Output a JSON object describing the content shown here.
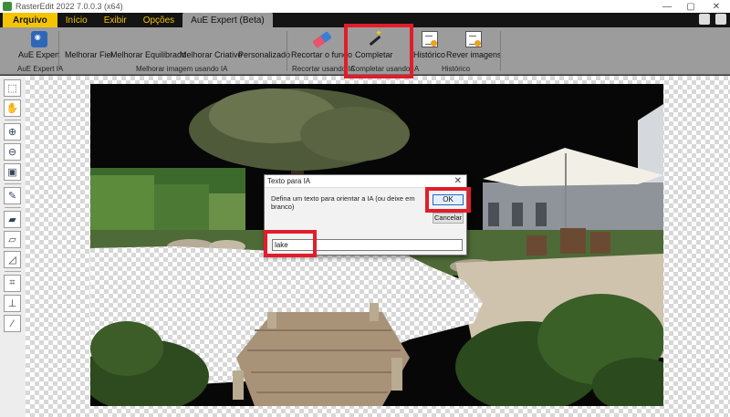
{
  "window": {
    "title": "RasterEdit 2022 7.0.0.3 (x64)",
    "min_glyph": "—",
    "max_glyph": "▢",
    "close_glyph": "✕"
  },
  "tabs": [
    {
      "label": "Arquivo"
    },
    {
      "label": "Início"
    },
    {
      "label": "Exibir"
    },
    {
      "label": "Opções"
    },
    {
      "label": "AuE Expert (Beta)"
    }
  ],
  "ribbon": {
    "buttons": {
      "aue_expert": {
        "label": "AuE Expert",
        "icon": "robot-icon"
      },
      "melhorar_fiel": {
        "label": "Melhorar Fiel",
        "icon": "image-enhance-icon"
      },
      "melhorar_equilibrado": {
        "label": "Melhorar Equilibrado",
        "icon": "image-enhance-icon"
      },
      "melhorar_criativo": {
        "label": "Melhorar Criativo",
        "icon": "image-enhance-icon"
      },
      "personalizado": {
        "label": "Personalizado",
        "icon": "image-settings-icon"
      },
      "recortar_fundo": {
        "label": "Recortar o fundo",
        "icon": "eraser-icon"
      },
      "completar": {
        "label": "Completar",
        "icon": "magic-wand-icon"
      },
      "historico": {
        "label": "Histórico",
        "icon": "document-icon"
      },
      "rever_imagens": {
        "label": "Rever imagens",
        "icon": "document-icon"
      }
    },
    "groups": {
      "aue_expert_ia": "AuE Expert IA",
      "melhorar_imagem": "Melhorar imagem usando IA",
      "recortar": "Recortar usando IA",
      "completar": "Completar usando IA",
      "historico": "Histórico"
    }
  },
  "dialog": {
    "title": "Texto para IA",
    "close": "✕",
    "message": "Defina um texto para orientar a IA (ou deixe em branco)",
    "ok_label": "OK",
    "cancel_label": "Cancelar",
    "input_value": "lake"
  },
  "colors": {
    "accent_tab": "#f5c400",
    "highlight": "#e21d2b"
  }
}
